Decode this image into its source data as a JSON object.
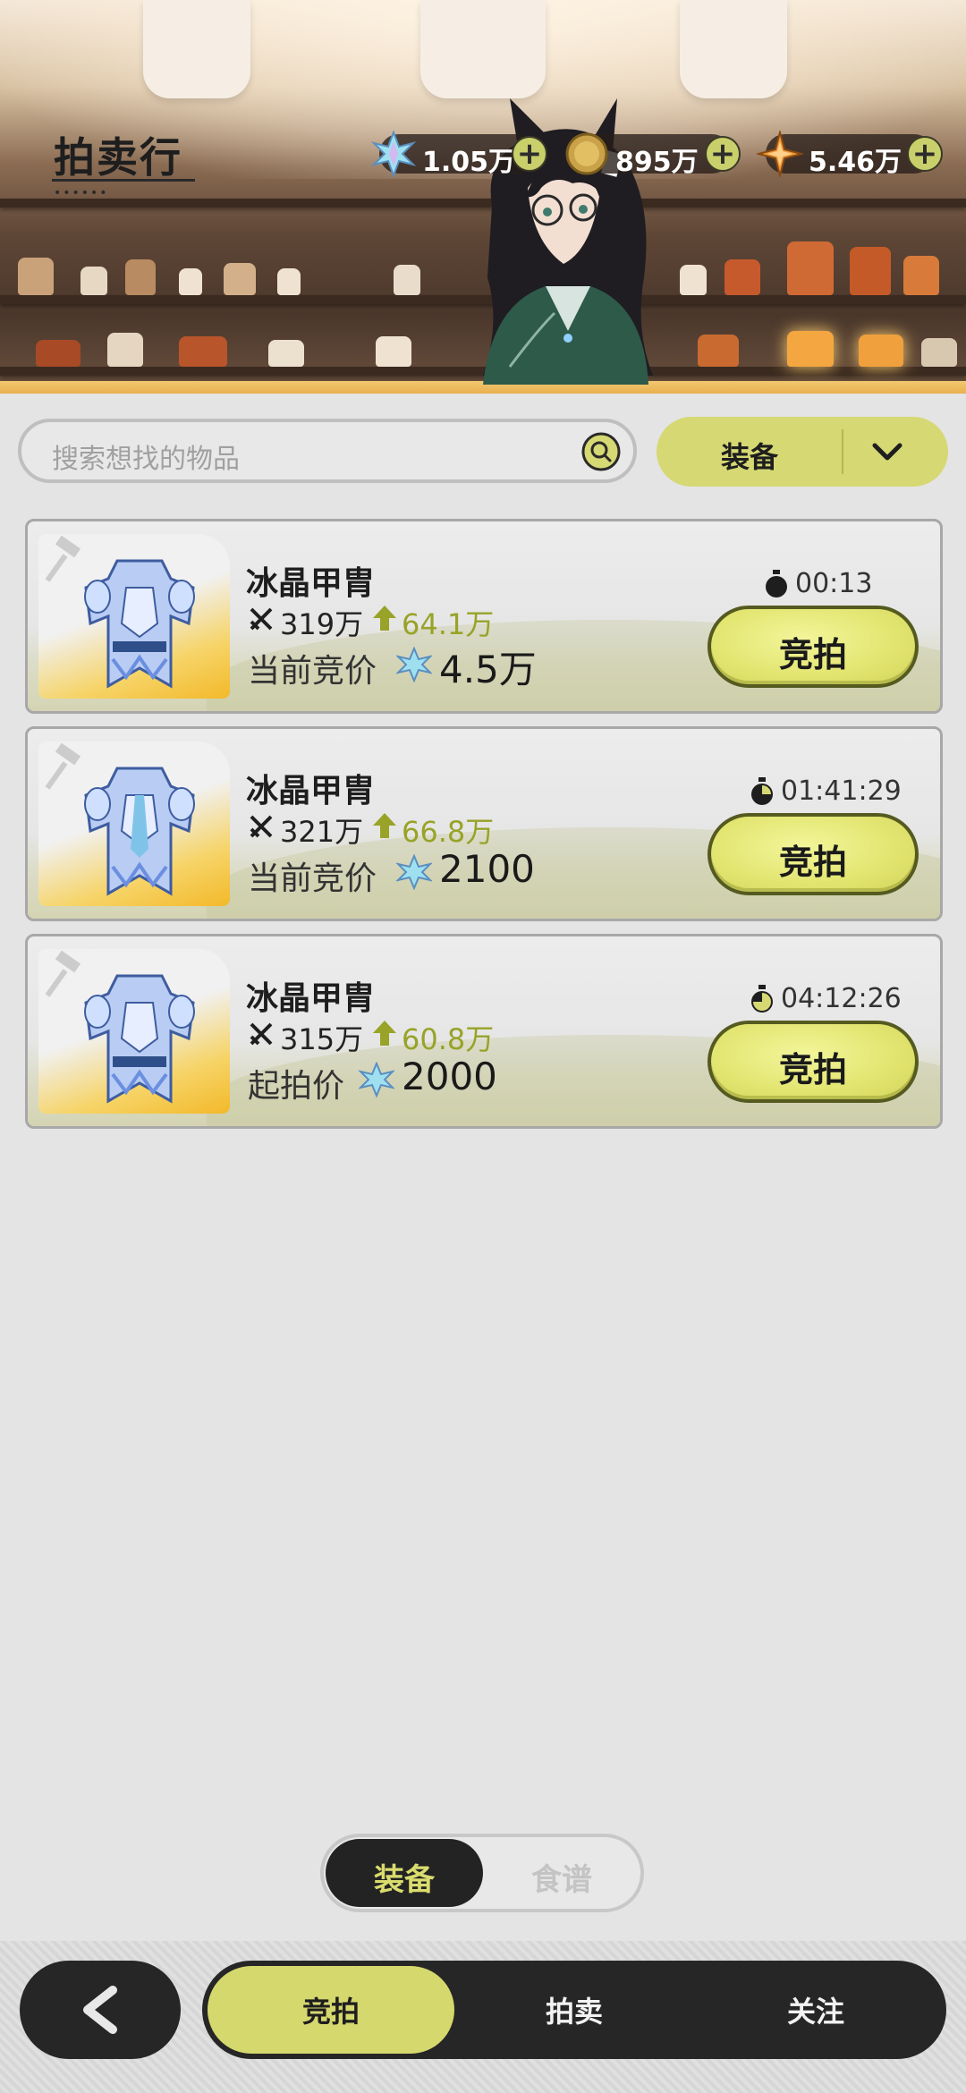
{
  "header": {
    "title": "拍卖行",
    "title_dots": "••••••"
  },
  "currencies": [
    {
      "name": "crystal",
      "icon": "crystal-gem-icon",
      "value": "1.05万"
    },
    {
      "name": "coin",
      "icon": "gold-coin-icon",
      "value": "895万"
    },
    {
      "name": "star",
      "icon": "orange-star-icon",
      "value": "5.46万"
    }
  ],
  "search": {
    "placeholder": "搜索想找的物品"
  },
  "category_filter": {
    "selected": "装备"
  },
  "listings": [
    {
      "name": "冰晶甲胄",
      "power": "319万",
      "power_up": "64.1万",
      "price_label": "当前竞价",
      "price": "4.5万",
      "timer": "00:13",
      "button": "竞拍"
    },
    {
      "name": "冰晶甲胄",
      "power": "321万",
      "power_up": "66.8万",
      "price_label": "当前竞价",
      "price": "2100",
      "timer": "01:41:29",
      "button": "竞拍"
    },
    {
      "name": "冰晶甲胄",
      "power": "315万",
      "power_up": "60.8万",
      "price_label": "起拍价",
      "price": "2000",
      "timer": "04:12:26",
      "button": "竞拍"
    }
  ],
  "segment": {
    "options": [
      "装备",
      "食谱"
    ],
    "active": "装备"
  },
  "bottom_nav": {
    "tabs": [
      "竞拍",
      "拍卖",
      "关注"
    ],
    "active": "竞拍"
  },
  "colors": {
    "accent": "#d5d86d",
    "price_up": "#98a327",
    "dark": "#262626"
  }
}
